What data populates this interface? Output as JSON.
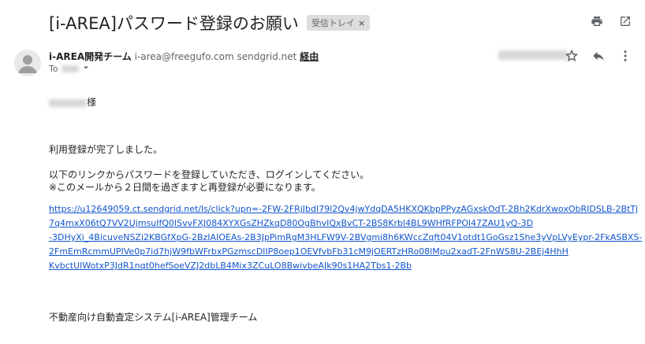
{
  "email": {
    "subject": "[i-AREA]パスワード登録のお願い",
    "label": "受信トレイ",
    "label_close": "×",
    "sender_name": "i-AREA開発チーム",
    "sender_address": "i-area@freegufo.com sendgrid.net",
    "via": "経由",
    "to_label": "To",
    "greeting_suffix": "様",
    "line1": "利用登録が完了しました。",
    "line2": "以下のリンクからパスワードを登録していただき、ログインしてください。",
    "line3": "※このメールから２日間を過ぎますと再登録が必要になります。",
    "link_lines": [
      "https://u12649059.ct.sendgrid.net/ls/click?upn=-2FW-2FRjJbdI79l2Qv4jwYdqDA5HKXQKbpPPyzAGxskOdT-2Bh2KdrXwoxObRIDSLB-2BtTj",
      "7q4mxX06tQ7VV2UjmsuIfQ0lSvvFXJ084XYXGsZHZkqD80OgBhvIQxBvCT-2BS8Krbl4BL9WHfRFPOl47ZAU1yQ-3D",
      "-3DHyXi_4BicuveNSZi2KBGfXpG-2BzIAIOEAs-2B3JpPimRgM3HLFW9V-2BVgmi8h6KWccZqft04V1otdt1GoGsz1She3yVpLVyEypr-2FkASBXS-",
      "2FmEmRcmmUPIVe0p7id7hjW9fbWFrbxPGzmscDlIP8oep1OEVfvbFb31cM9jOERTzHRo08lMpu2xadT-2FnWS8U-2BEj4HhH",
      "KvbctUIWotxP3JdR1nqt0hefSoeVZJ2dbLB4Mix3ZCuLO8BwivbeAJk90s1HA2Tbs1-2Bb"
    ],
    "signature": "不動産向け自動査定システム[i-AREA]管理チーム"
  },
  "icons": {
    "print": "print-icon",
    "open_new": "open-in-new-icon",
    "avatar": "avatar-person-icon",
    "star": "star-icon",
    "reply": "reply-icon",
    "more": "more-vert-icon",
    "to_dropdown": "chevron-down-icon"
  }
}
